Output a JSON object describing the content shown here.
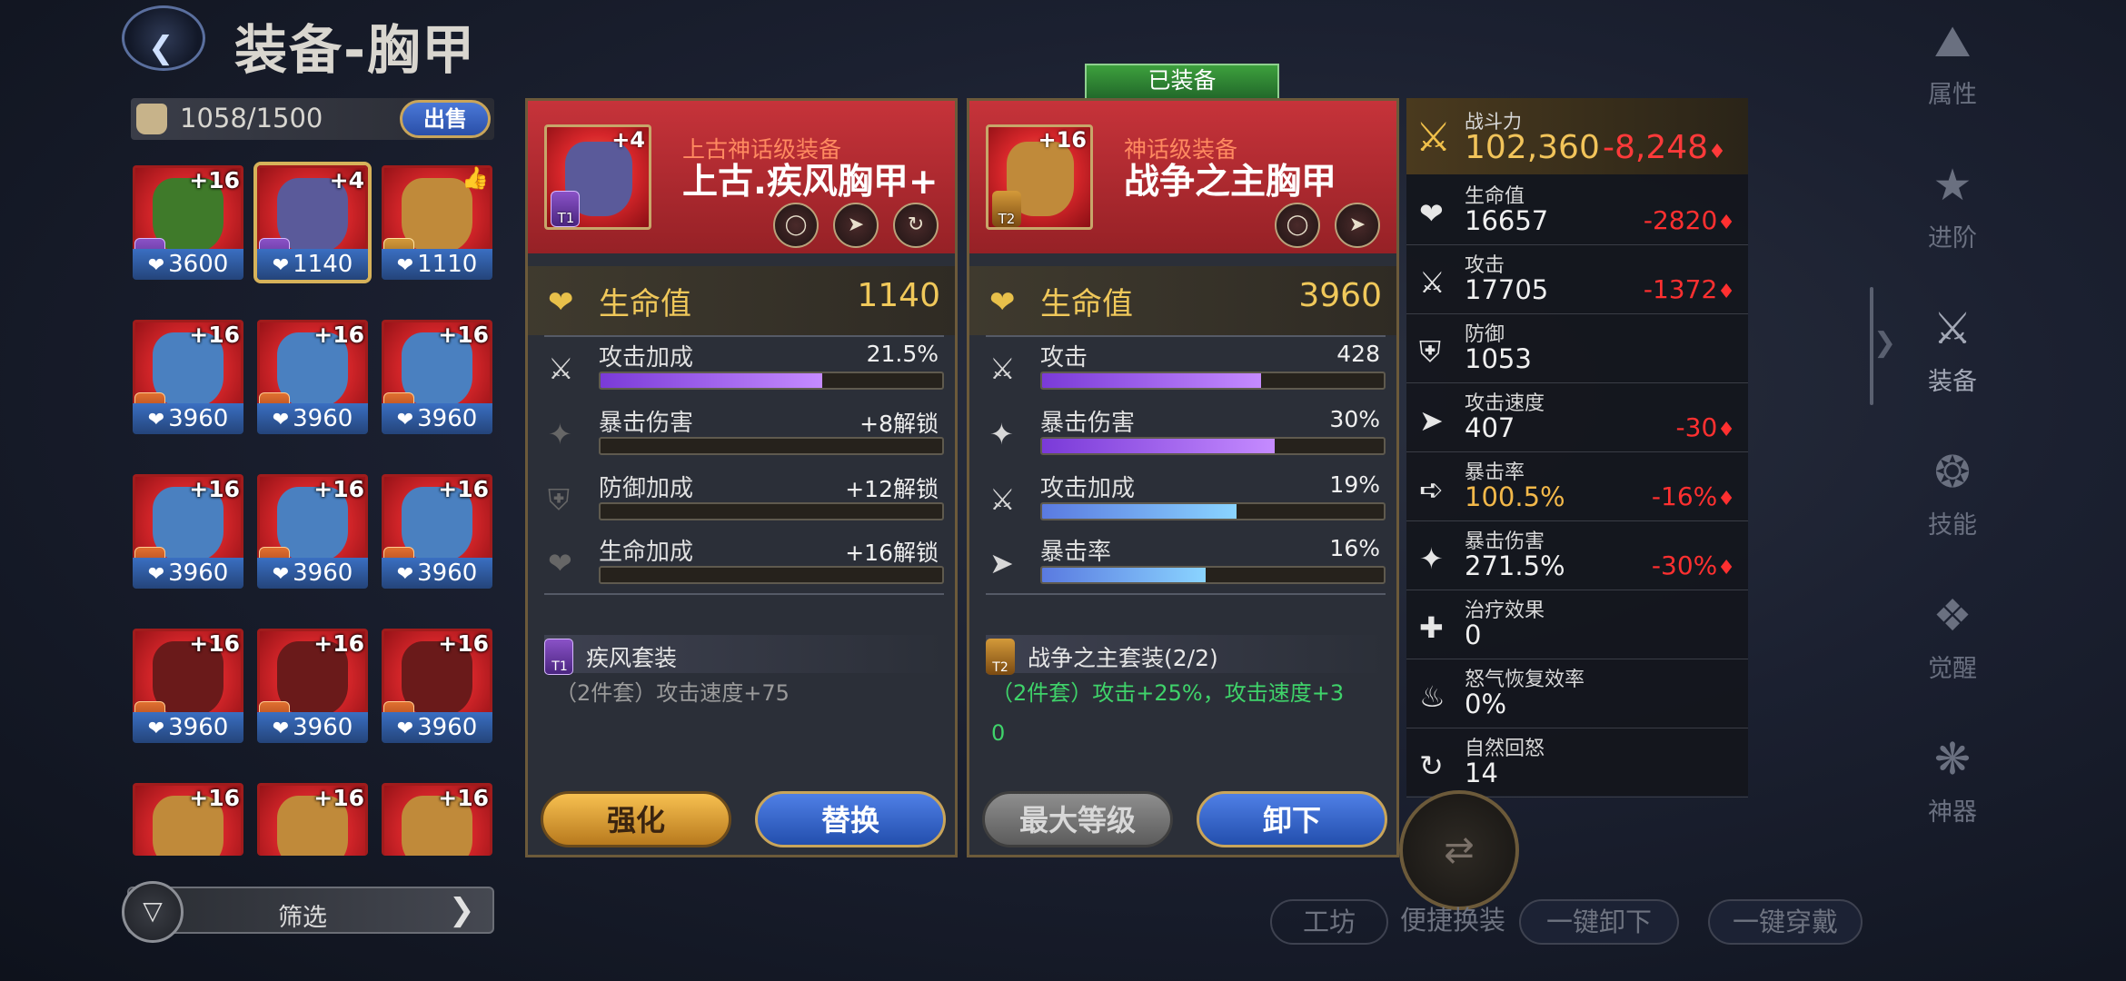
{
  "header": {
    "title": "装备-胸甲",
    "back_icon": "back-arrow-icon"
  },
  "inventory": {
    "count": "1058/1500",
    "sell_label": "出售"
  },
  "grid": [
    {
      "level": "+16",
      "tier": "T1",
      "tier_color": "purple",
      "hp": "3600",
      "art": "#3f7a2a",
      "red": true
    },
    {
      "level": "+4",
      "tier": "T1",
      "tier_color": "purple",
      "hp": "1140",
      "art": "#5a5a9a",
      "red": true,
      "selected": true
    },
    {
      "level": "",
      "tier": "T2",
      "tier_color": "gold",
      "hp": "1110",
      "art": "#c08a3a",
      "red": true,
      "thumb": "👍"
    },
    {
      "level": "+16",
      "tier": "T3",
      "tier_color": "orange",
      "hp": "3960",
      "art": "#4a80c0",
      "red": true
    },
    {
      "level": "+16",
      "tier": "T3",
      "tier_color": "orange",
      "hp": "3960",
      "art": "#4a80c0",
      "red": true
    },
    {
      "level": "+16",
      "tier": "T3",
      "tier_color": "orange",
      "hp": "3960",
      "art": "#4a80c0",
      "red": true
    },
    {
      "level": "+16",
      "tier": "T3",
      "tier_color": "orange",
      "hp": "3960",
      "art": "#4a80c0",
      "red": true
    },
    {
      "level": "+16",
      "tier": "T3",
      "tier_color": "orange",
      "hp": "3960",
      "art": "#4a80c0",
      "red": true
    },
    {
      "level": "+16",
      "tier": "T3",
      "tier_color": "orange",
      "hp": "3960",
      "art": "#4a80c0",
      "red": true
    },
    {
      "level": "+16",
      "tier": "T3",
      "tier_color": "orange",
      "hp": "3960",
      "art": "#6a1a1a",
      "red": true
    },
    {
      "level": "+16",
      "tier": "T3",
      "tier_color": "orange",
      "hp": "3960",
      "art": "#6a1a1a",
      "red": true
    },
    {
      "level": "+16",
      "tier": "T3",
      "tier_color": "orange",
      "hp": "3960",
      "art": "#6a1a1a",
      "red": true
    },
    {
      "level": "+16",
      "tier": "",
      "tier_color": "",
      "hp": "",
      "art": "#c08a3a",
      "red": true
    },
    {
      "level": "+16",
      "tier": "",
      "tier_color": "",
      "hp": "",
      "art": "#c08a3a",
      "red": true
    },
    {
      "level": "+16",
      "tier": "",
      "tier_color": "",
      "hp": "",
      "art": "#c08a3a",
      "red": true
    }
  ],
  "filter": {
    "label": "筛选"
  },
  "left_item": {
    "level": "+4",
    "tier": "T1",
    "grade": "上古神话级装备",
    "name": "上古.疾风胸甲+",
    "main_stat": {
      "label": "生命值",
      "value": "1140"
    },
    "subs": [
      {
        "label": "攻击加成",
        "value": "21.5%",
        "fill": 0.65,
        "style": "purple",
        "locked": false,
        "icon": "sword-plus-icon"
      },
      {
        "label": "暴击伤害",
        "value": "+8解锁",
        "fill": 0,
        "style": "gray",
        "locked": true,
        "icon": "crit-damage-icon"
      },
      {
        "label": "防御加成",
        "value": "+12解锁",
        "fill": 0,
        "style": "gray",
        "locked": true,
        "icon": "shield-plus-icon"
      },
      {
        "label": "生命加成",
        "value": "+16解锁",
        "fill": 0,
        "style": "gray",
        "locked": true,
        "icon": "heart-plus-icon"
      }
    ],
    "set": {
      "tier": "T1",
      "name": "疾风套装",
      "desc": "（2件套）攻击速度+75",
      "active": false
    },
    "buttons": {
      "primary": "强化",
      "secondary": "替换"
    }
  },
  "equipped_tag": "已装备",
  "right_item": {
    "level": "+16",
    "tier": "T2",
    "grade": "神话级装备",
    "name": "战争之主胸甲",
    "main_stat": {
      "label": "生命值",
      "value": "3960"
    },
    "subs": [
      {
        "label": "攻击",
        "value": "428",
        "fill": 0.64,
        "style": "purple",
        "locked": false,
        "icon": "sword-icon"
      },
      {
        "label": "暴击伤害",
        "value": "30%",
        "fill": 0.68,
        "style": "purple",
        "locked": false,
        "icon": "crit-damage-icon"
      },
      {
        "label": "攻击加成",
        "value": "19%",
        "fill": 0.57,
        "style": "blue",
        "locked": false,
        "icon": "sword-plus-icon"
      },
      {
        "label": "暴击率",
        "value": "16%",
        "fill": 0.48,
        "style": "blue",
        "locked": false,
        "icon": "crit-rate-icon"
      }
    ],
    "set": {
      "tier": "T2",
      "name": "战争之主套装(2/2)",
      "desc1": "（2件套）攻击+25%，攻击速度+3",
      "desc2": "0",
      "active": true
    },
    "buttons": {
      "primary": "最大等级",
      "secondary": "卸下"
    }
  },
  "stats": {
    "power": {
      "label": "战斗力",
      "value": "102,360",
      "delta": "-8,248"
    },
    "rows": [
      {
        "label": "生命值",
        "value": "16657",
        "delta": "-2820",
        "icon": "heart-icon",
        "gold": false
      },
      {
        "label": "攻击",
        "value": "17705",
        "delta": "-1372",
        "icon": "sword-icon",
        "gold": false
      },
      {
        "label": "防御",
        "value": "1053",
        "delta": "",
        "icon": "shield-icon",
        "gold": false
      },
      {
        "label": "攻击速度",
        "value": "407",
        "delta": "-30",
        "icon": "attack-speed-icon",
        "gold": false
      },
      {
        "label": "暴击率",
        "value": "100.5%",
        "delta": "-16%",
        "icon": "crit-rate-icon",
        "gold": true
      },
      {
        "label": "暴击伤害",
        "value": "271.5%",
        "delta": "-30%",
        "icon": "crit-damage-icon",
        "gold": false
      },
      {
        "label": "治疗效果",
        "value": "0",
        "delta": "",
        "icon": "heal-icon",
        "gold": false
      },
      {
        "label": "怒气恢复效率",
        "value": "0%",
        "delta": "",
        "icon": "rage-icon",
        "gold": false
      },
      {
        "label": "自然回怒",
        "value": "14",
        "delta": "",
        "icon": "rage-regen-icon",
        "gold": false
      }
    ]
  },
  "nav": [
    {
      "label": "属性",
      "icon": "attributes-icon",
      "active": false
    },
    {
      "label": "进阶",
      "icon": "advance-icon",
      "active": false
    },
    {
      "label": "装备",
      "icon": "equipment-icon",
      "active": true
    },
    {
      "label": "技能",
      "icon": "skill-icon",
      "active": false
    },
    {
      "label": "觉醒",
      "icon": "awaken-icon",
      "active": false
    },
    {
      "label": "神器",
      "icon": "artifact-icon",
      "active": false
    }
  ],
  "bottom": {
    "workshop": "工坊",
    "quick_swap": "便捷换装",
    "unequip_all": "一键卸下",
    "equip_all": "一键穿戴"
  }
}
